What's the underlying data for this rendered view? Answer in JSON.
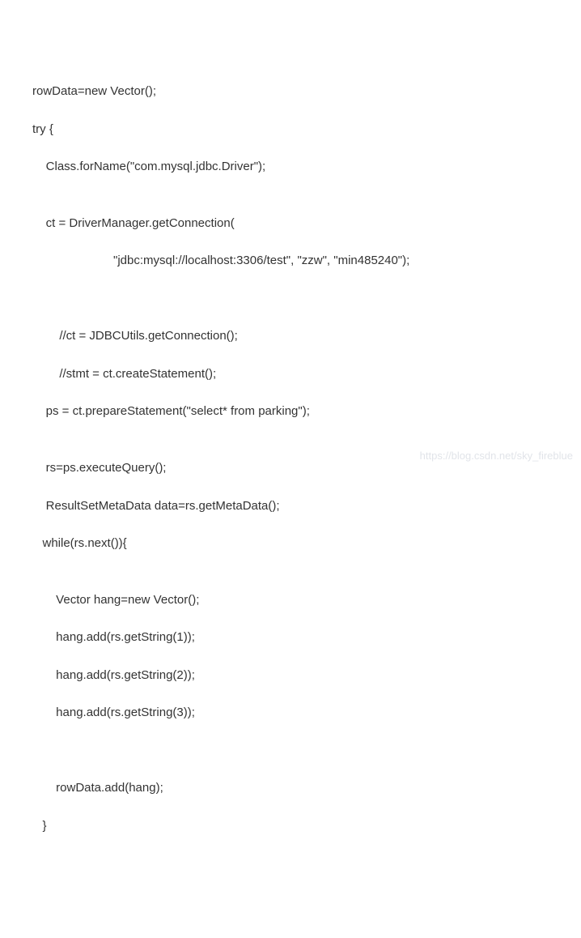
{
  "code": {
    "lines": [
      "rowData=new Vector();",
      "try {",
      "    Class.forName(\"com.mysql.jdbc.Driver\");",
      "",
      "    ct = DriverManager.getConnection(",
      "                        \"jdbc:mysql://localhost:3306/test\", \"zzw\", \"min485240\");",
      "",
      "",
      "        //ct = JDBCUtils.getConnection();",
      "        //stmt = ct.createStatement();",
      "    ps = ct.prepareStatement(\"select* from parking\");",
      "",
      "    rs=ps.executeQuery();",
      "    ResultSetMetaData data=rs.getMetaData();",
      "   while(rs.next()){",
      "",
      "       Vector hang=new Vector();",
      "       hang.add(rs.getString(1));",
      "       hang.add(rs.getString(2));",
      "       hang.add(rs.getString(3));",
      "",
      "",
      "       rowData.add(hang);",
      "   }"
    ]
  },
  "watermark": "https://blog.csdn.net/sky_fireblue"
}
